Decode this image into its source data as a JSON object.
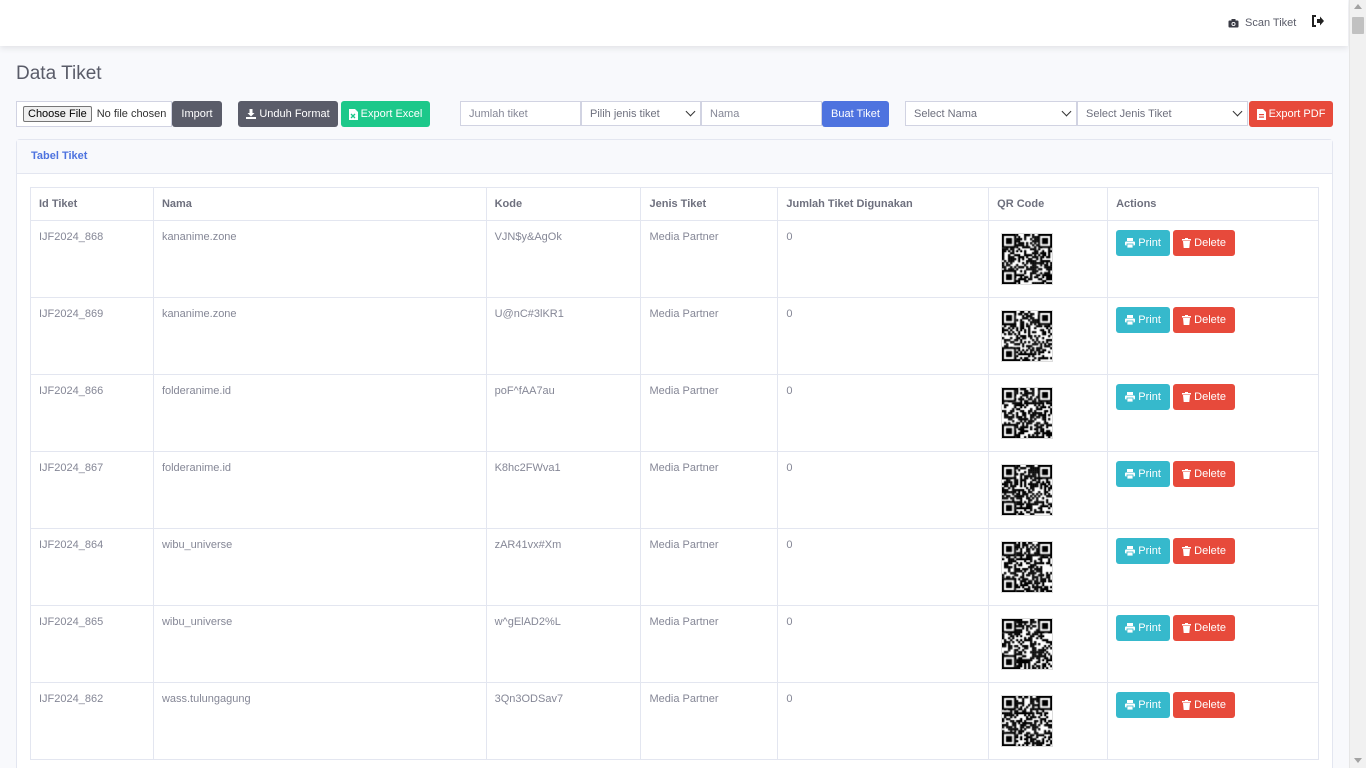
{
  "topbar": {
    "scan_label": "Scan Tiket",
    "scan_icon": "camera-icon",
    "logout_icon": "sign-out-icon"
  },
  "page": {
    "title": "Data Tiket"
  },
  "toolbar": {
    "file_button": "Choose File",
    "file_status": "No file chosen",
    "import_label": "Import",
    "unduh_label": "Unduh Format",
    "export_excel_label": "Export Excel",
    "jumlah_placeholder": "Jumlah tiket",
    "jenis_select": "Pilih jenis tiket",
    "nama_placeholder": "Nama",
    "buat_label": "Buat Tiket",
    "select_nama": "Select Nama",
    "select_jenis": "Select Jenis Tiket",
    "export_pdf_label": "Export PDF"
  },
  "card": {
    "title": "Tabel Tiket"
  },
  "table": {
    "headers": [
      "Id Tiket",
      "Nama",
      "Kode",
      "Jenis Tiket",
      "Jumlah Tiket Digunakan",
      "QR Code",
      "Actions"
    ],
    "print_label": "Print",
    "delete_label": "Delete",
    "rows": [
      {
        "id": "IJF2024_868",
        "nama": "kananime.zone",
        "kode": "VJN$y&AgOk",
        "jenis": "Media Partner",
        "jumlah": "0"
      },
      {
        "id": "IJF2024_869",
        "nama": "kananime.zone",
        "kode": "U@nC#3lKR1",
        "jenis": "Media Partner",
        "jumlah": "0"
      },
      {
        "id": "IJF2024_866",
        "nama": "folderanime.id",
        "kode": "poF^fAA7au",
        "jenis": "Media Partner",
        "jumlah": "0"
      },
      {
        "id": "IJF2024_867",
        "nama": "folderanime.id",
        "kode": "K8hc2FWva1",
        "jenis": "Media Partner",
        "jumlah": "0"
      },
      {
        "id": "IJF2024_864",
        "nama": "wibu_universe",
        "kode": "zAR41vx#Xm",
        "jenis": "Media Partner",
        "jumlah": "0"
      },
      {
        "id": "IJF2024_865",
        "nama": "wibu_universe",
        "kode": "w^gElAD2%L",
        "jenis": "Media Partner",
        "jumlah": "0"
      },
      {
        "id": "IJF2024_862",
        "nama": "wass.tulungagung",
        "kode": "3Qn3ODSav7",
        "jenis": "Media Partner",
        "jumlah": "0"
      }
    ]
  },
  "colors": {
    "primary": "#4e73df",
    "success": "#1cc88a",
    "info": "#36b9cc",
    "danger": "#e74a3b",
    "dark": "#5a5c69"
  }
}
